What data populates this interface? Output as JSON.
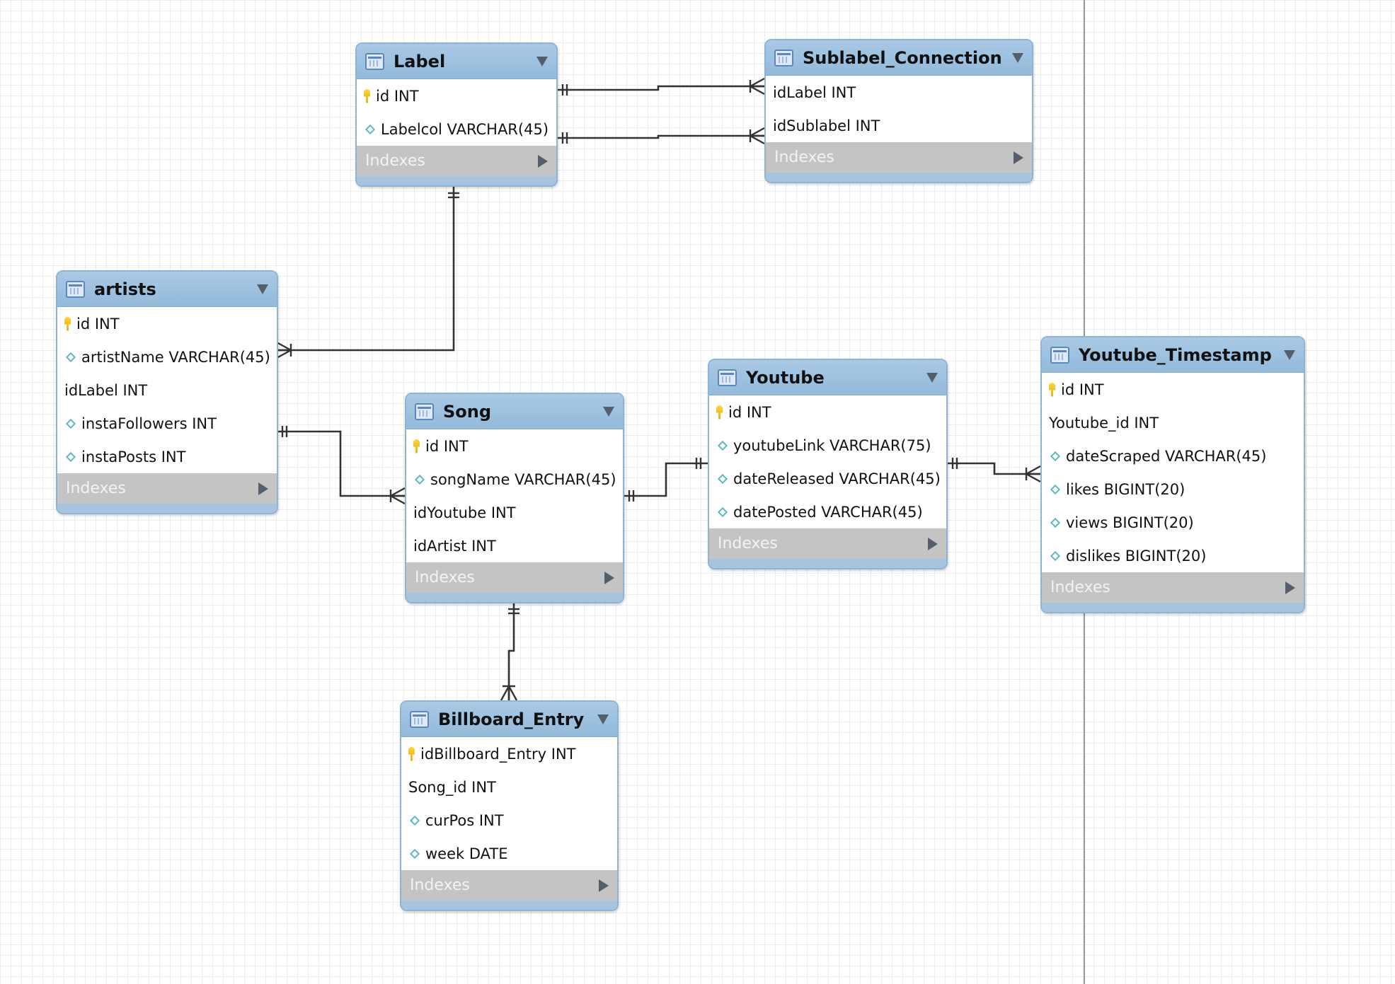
{
  "diagram": {
    "indexes_label": "Indexes",
    "tables": {
      "label": {
        "name": "Label",
        "columns": [
          {
            "text": "id INT",
            "icon": "primary-key-icon"
          },
          {
            "text": "Labelcol VARCHAR(45)",
            "icon": "column-diamond-icon"
          }
        ]
      },
      "sublabel_connection": {
        "name": "Sublabel_Connection",
        "columns": [
          {
            "text": "idLabel INT",
            "icon": "none"
          },
          {
            "text": "idSublabel INT",
            "icon": "none"
          }
        ]
      },
      "artists": {
        "name": "artists",
        "columns": [
          {
            "text": "id INT",
            "icon": "primary-key-icon"
          },
          {
            "text": "artistName VARCHAR(45)",
            "icon": "column-diamond-icon"
          },
          {
            "text": "idLabel INT",
            "icon": "none"
          },
          {
            "text": "instaFollowers INT",
            "icon": "column-diamond-icon"
          },
          {
            "text": "instaPosts INT",
            "icon": "column-diamond-icon"
          }
        ]
      },
      "song": {
        "name": "Song",
        "columns": [
          {
            "text": "id INT",
            "icon": "primary-key-icon"
          },
          {
            "text": "songName VARCHAR(45)",
            "icon": "column-diamond-icon"
          },
          {
            "text": "idYoutube INT",
            "icon": "none"
          },
          {
            "text": "idArtist INT",
            "icon": "none"
          }
        ]
      },
      "youtube": {
        "name": "Youtube",
        "columns": [
          {
            "text": "id INT",
            "icon": "primary-key-icon"
          },
          {
            "text": "youtubeLink VARCHAR(75)",
            "icon": "column-diamond-icon"
          },
          {
            "text": "dateReleased VARCHAR(45)",
            "icon": "column-diamond-icon"
          },
          {
            "text": "datePosted VARCHAR(45)",
            "icon": "column-diamond-icon"
          }
        ]
      },
      "youtube_timestamp": {
        "name": "Youtube_Timestamp",
        "columns": [
          {
            "text": "id INT",
            "icon": "primary-key-icon"
          },
          {
            "text": "Youtube_id INT",
            "icon": "none"
          },
          {
            "text": "dateScraped VARCHAR(45)",
            "icon": "column-diamond-icon"
          },
          {
            "text": "likes BIGINT(20)",
            "icon": "column-diamond-icon"
          },
          {
            "text": "views BIGINT(20)",
            "icon": "column-diamond-icon"
          },
          {
            "text": "dislikes BIGINT(20)",
            "icon": "column-diamond-icon"
          }
        ]
      },
      "billboard_entry": {
        "name": "Billboard_Entry",
        "columns": [
          {
            "text": "idBillboard_Entry INT",
            "icon": "primary-key-icon"
          },
          {
            "text": "Song_id INT",
            "icon": "none"
          },
          {
            "text": "curPos INT",
            "icon": "column-diamond-icon"
          },
          {
            "text": "week DATE",
            "icon": "column-diamond-icon"
          }
        ]
      }
    },
    "relationships": [
      {
        "from": "Label",
        "to": "Sublabel_Connection",
        "from_end": "one",
        "to_end": "many"
      },
      {
        "from": "Label",
        "to": "Sublabel_Connection",
        "from_end": "one",
        "to_end": "many"
      },
      {
        "from": "Label",
        "to": "artists",
        "from_end": "one",
        "to_end": "many"
      },
      {
        "from": "artists",
        "to": "Song",
        "from_end": "one",
        "to_end": "many"
      },
      {
        "from": "Song",
        "to": "Youtube",
        "from_end": "one",
        "to_end": "one"
      },
      {
        "from": "Youtube",
        "to": "Youtube_Timestamp",
        "from_end": "one",
        "to_end": "many"
      },
      {
        "from": "Song",
        "to": "Billboard_Entry",
        "from_end": "one",
        "to_end": "many"
      }
    ]
  }
}
